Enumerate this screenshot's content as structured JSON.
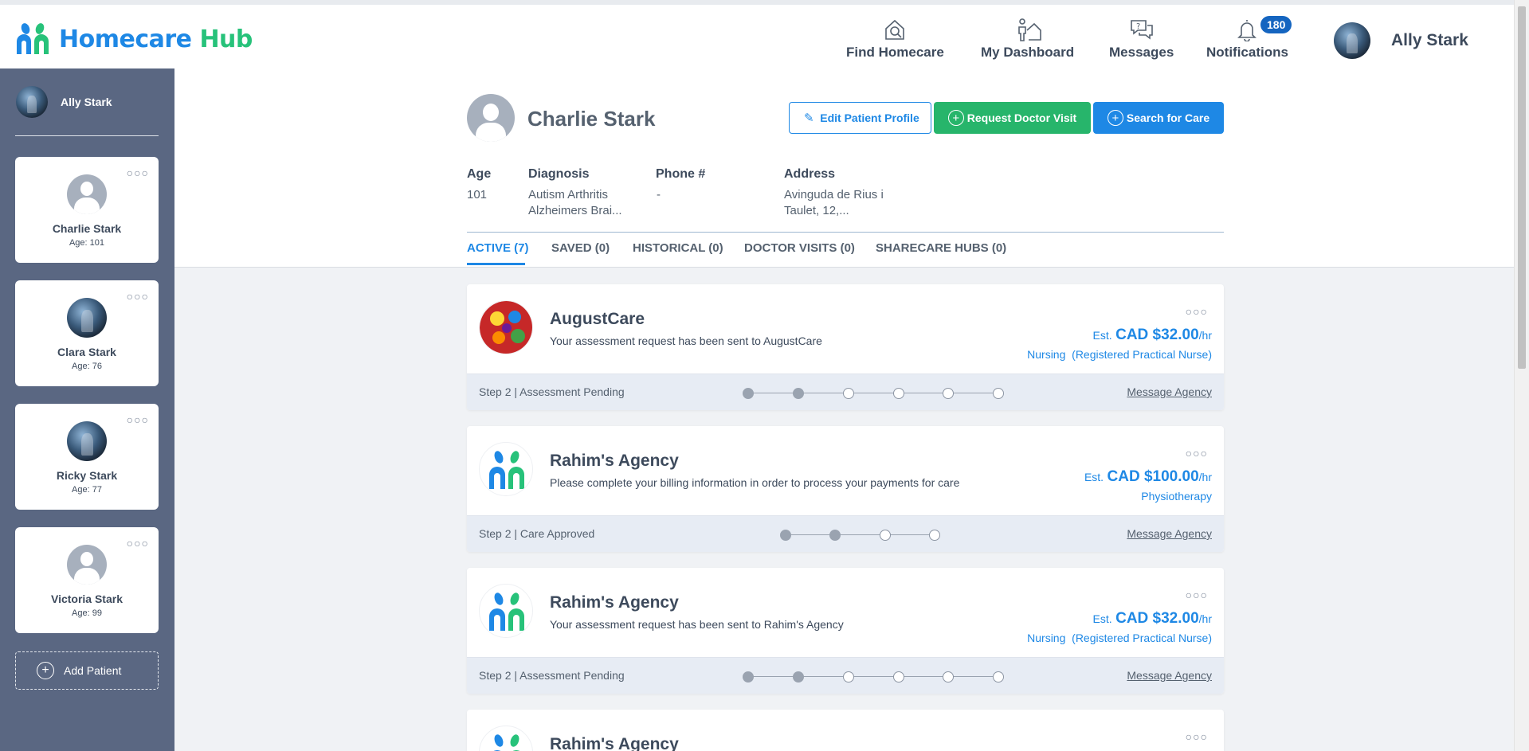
{
  "header": {
    "logo_primary": "Homecare",
    "logo_secondary": "Hub",
    "nav": [
      {
        "label": "Find Homecare",
        "icon": "home-search-icon"
      },
      {
        "label": "My Dashboard",
        "icon": "person-house-icon"
      },
      {
        "label": "Messages",
        "icon": "chat-question-icon"
      },
      {
        "label": "Notifications",
        "icon": "bell-icon",
        "badge": "180"
      }
    ],
    "user_name": "Ally Stark"
  },
  "sidebar": {
    "user_name": "Ally Stark",
    "patients": [
      {
        "name": "Charlie Stark",
        "age_label": "Age:",
        "age": "101",
        "avatar": "default"
      },
      {
        "name": "Clara Stark",
        "age_label": "Age:",
        "age": "76",
        "avatar": "photo"
      },
      {
        "name": "Ricky Stark",
        "age_label": "Age:",
        "age": "77",
        "avatar": "photo"
      },
      {
        "name": "Victoria Stark",
        "age_label": "Age:",
        "age": "99",
        "avatar": "default"
      }
    ],
    "add_patient_label": "Add Patient"
  },
  "patient": {
    "name": "Charlie Stark",
    "buttons": {
      "edit": "Edit Patient Profile",
      "doctor": "Request Doctor Visit",
      "search": "Search for Care"
    },
    "fields": {
      "age_label": "Age",
      "age": "101",
      "diagnosis_label": "Diagnosis",
      "diagnosis_line1": "Autism Arthritis",
      "diagnosis_line2": "Alzheimers Brai...",
      "phone_label": "Phone #",
      "phone": "-",
      "address_label": "Address",
      "address_line1": "Avinguda de Rius i",
      "address_line2": "Taulet, 12,..."
    },
    "tabs": [
      {
        "label": "ACTIVE (7)",
        "active": true
      },
      {
        "label": "SAVED (0)",
        "active": false
      },
      {
        "label": "HISTORICAL (0)",
        "active": false
      },
      {
        "label": "DOCTOR VISITS (0)",
        "active": false
      },
      {
        "label": "SHARECARE HUBS (0)",
        "active": false
      }
    ]
  },
  "requests": [
    {
      "agency": "AugustCare",
      "description": "Your assessment request has been sent to AugustCare",
      "est": "Est.",
      "amount": "CAD $32.00",
      "unit": "/hr",
      "service": "Nursing  (Registered Practical Nurse)",
      "step": "Step 2 | Assessment Pending",
      "steps_total": 6,
      "steps_done": 2,
      "message": "Message Agency",
      "logo": "froot-loops"
    },
    {
      "agency": "Rahim's Agency",
      "description": "Please complete your billing information in order to process your payments for care",
      "est": "Est.",
      "amount": "CAD $100.00",
      "unit": "/hr",
      "service": "Physiotherapy",
      "step": "Step 2 | Care Approved",
      "steps_total": 4,
      "steps_done": 2,
      "message": "Message Agency",
      "logo": "homecare-hub"
    },
    {
      "agency": "Rahim's Agency",
      "description": "Your assessment request has been sent to Rahim's Agency",
      "est": "Est.",
      "amount": "CAD $32.00",
      "unit": "/hr",
      "service": "Nursing  (Registered Practical Nurse)",
      "step": "Step 2 | Assessment Pending",
      "steps_total": 6,
      "steps_done": 2,
      "message": "Message Agency",
      "logo": "homecare-hub"
    },
    {
      "agency": "Rahim's Agency",
      "logo": "homecare-hub"
    }
  ],
  "colors": {
    "brand_blue": "#1e88e5",
    "brand_green": "#27c27a",
    "sidebar": "#5a6782",
    "button_green": "#27b56b"
  }
}
